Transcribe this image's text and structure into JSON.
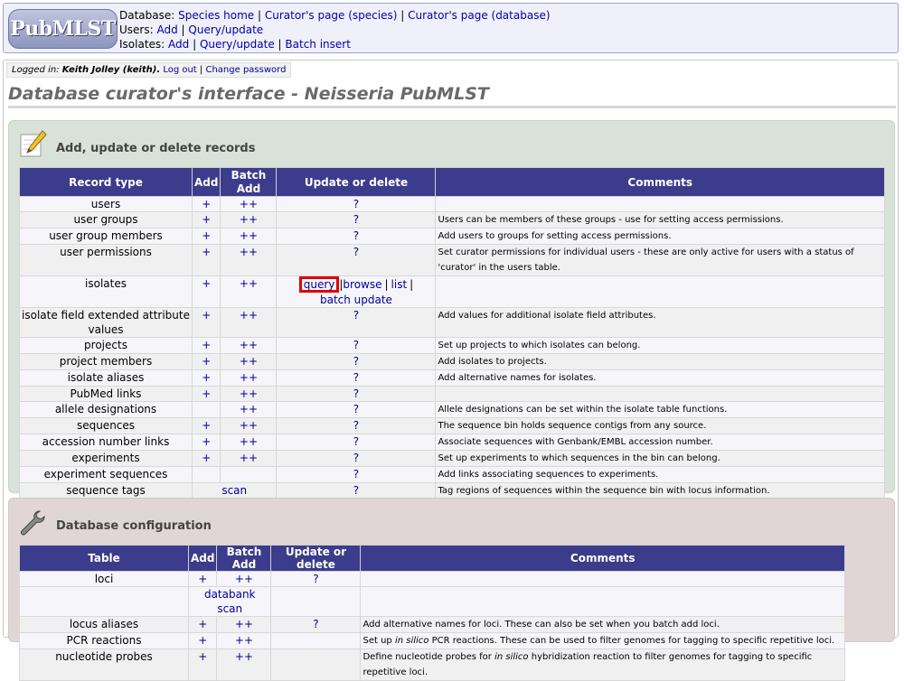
{
  "header": {
    "logo": "PubMLST",
    "line1_label": "Database:",
    "line1_links": [
      "Species home",
      "Curator's page (species)",
      "Curator's page (database)"
    ],
    "line2_label": "Users:",
    "line2_links": [
      "Add",
      "Query/update"
    ],
    "line3_label": "Isolates:",
    "line3_links": [
      "Add",
      "Query/update",
      "Batch insert"
    ],
    "sep": " | "
  },
  "login": {
    "prefix": "Logged in:",
    "user": "Keith Jolley (keith).",
    "logout": "Log out",
    "change_password": "Change password",
    "sep": "|"
  },
  "page_title": "Database curator's interface - Neisseria PubMLST",
  "records": {
    "title": "Add, update or delete records",
    "icon": "pencil-icon",
    "headers": [
      "Record type",
      "Add",
      "Batch Add",
      "Update or delete",
      "Comments"
    ],
    "rows": [
      {
        "type": "users",
        "add": "+",
        "batch": "++",
        "update": "?",
        "comment": ""
      },
      {
        "type": "user groups",
        "add": "+",
        "batch": "++",
        "update": "?",
        "comment": "Users can be members of these groups - use for setting access permissions."
      },
      {
        "type": "user group members",
        "add": "+",
        "batch": "++",
        "update": "?",
        "comment": "Add users to groups for setting access permissions."
      },
      {
        "type": "user permissions",
        "add": "+",
        "batch": "++",
        "update": "?",
        "comment": "Set curator permissions for individual users - these are only active for users with a status of 'curator' in the users table."
      },
      {
        "type": "isolates",
        "add": "+",
        "batch": "++",
        "update": "",
        "comment": ""
      },
      {
        "type": "isolate field extended attribute values",
        "add": "+",
        "batch": "++",
        "update": "?",
        "comment": "Add values for additional isolate field attributes."
      },
      {
        "type": "projects",
        "add": "+",
        "batch": "++",
        "update": "?",
        "comment": "Set up projects to which isolates can belong."
      },
      {
        "type": "project members",
        "add": "+",
        "batch": "++",
        "update": "?",
        "comment": "Add isolates to projects."
      },
      {
        "type": "isolate aliases",
        "add": "+",
        "batch": "++",
        "update": "?",
        "comment": "Add alternative names for isolates."
      },
      {
        "type": "PubMed links",
        "add": "+",
        "batch": "++",
        "update": "?",
        "comment": ""
      },
      {
        "type": "allele designations",
        "add": "",
        "batch": "++",
        "update": "?",
        "comment": "Allele designations can be set within the isolate table functions."
      },
      {
        "type": "sequences",
        "add": "+",
        "batch": "++",
        "update": "?",
        "comment": "The sequence bin holds sequence contigs from any source."
      },
      {
        "type": "accession number links",
        "add": "+",
        "batch": "++",
        "update": "?",
        "comment": "Associate sequences with Genbank/EMBL accession number."
      },
      {
        "type": "experiments",
        "add": "+",
        "batch": "++",
        "update": "?",
        "comment": "Set up experiments to which sequences in the bin can belong."
      },
      {
        "type": "experiment sequences",
        "add": "",
        "batch": "",
        "update": "?",
        "comment": "Add links associating sequences to experiments."
      },
      {
        "type": "sequence tags",
        "add": "",
        "batch": "",
        "update": "?",
        "comment": "Tag regions of sequences within the sequence bin with locus information."
      }
    ],
    "isolates_update": {
      "query": "query",
      "browse": "browse",
      "list": "list",
      "batch_update": "batch update",
      "sep": "|"
    },
    "sequence_tags_scan": "scan"
  },
  "config": {
    "title": "Database configuration",
    "icon": "wrench-icon",
    "headers": [
      "Table",
      "Add",
      "Batch Add",
      "Update or delete",
      "Comments"
    ],
    "rows": [
      {
        "type": "loci",
        "add": "+",
        "batch": "++",
        "update": "?",
        "comment": ""
      },
      {
        "type": "locus aliases",
        "add": "+",
        "batch": "++",
        "update": "?",
        "comment": "Add alternative names for loci. These can also be set when you batch add loci."
      },
      {
        "type": "PCR reactions",
        "add": "+",
        "batch": "++",
        "update": "",
        "comment_pre": "Set up ",
        "comment_em": "in silico",
        "comment_post": " PCR reactions. These can be used to filter genomes for tagging to specific repetitive loci."
      },
      {
        "type": "nucleotide probes",
        "add": "+",
        "batch": "++",
        "update": "",
        "comment_pre": "Define nucleotide probes for ",
        "comment_em": "in silico",
        "comment_post": " hybridization reaction to filter genomes for tagging to specific repetitive loci."
      }
    ],
    "loci_databank_scan": "databank scan"
  }
}
